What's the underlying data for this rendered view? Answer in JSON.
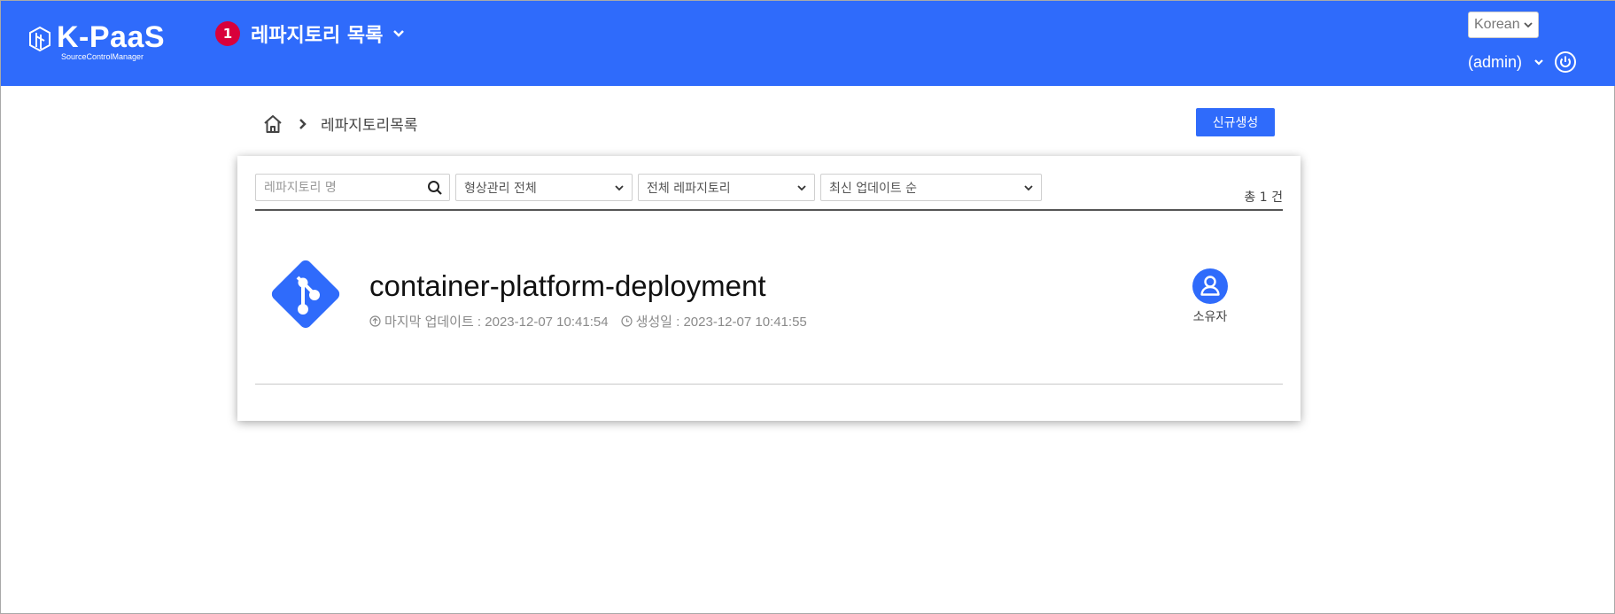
{
  "header": {
    "logo_title": "K-PaaS",
    "logo_subtitle": "SourceControlManager",
    "menu_badge": "1",
    "menu_title": "레파지토리 목록",
    "language": "Korean",
    "user": "(admin)",
    "brand_color": "#2f6bfb",
    "badge_color": "#d9003b"
  },
  "breadcrumb": {
    "current": "레파지토리목록"
  },
  "actions": {
    "new_button": "신규생성"
  },
  "filters": {
    "search_placeholder": "레파지토리 명",
    "scm_type": "형상관리 전체",
    "repo_scope": "전체 레파지토리",
    "sort": "최신 업데이트 순",
    "total_count": "총 1 건"
  },
  "repositories": [
    {
      "name": "container-platform-deployment",
      "last_update_label": "마지막 업데이트 : 2023-12-07 10:41:54",
      "created_label": "생성일 : 2023-12-07 10:41:55",
      "role": "소유자"
    }
  ],
  "icons": [
    "logo-icon",
    "chevron-down-icon",
    "power-icon",
    "home-icon",
    "chevron-right-icon",
    "search-icon",
    "git-icon",
    "upload-icon",
    "clock-icon",
    "user-icon"
  ]
}
